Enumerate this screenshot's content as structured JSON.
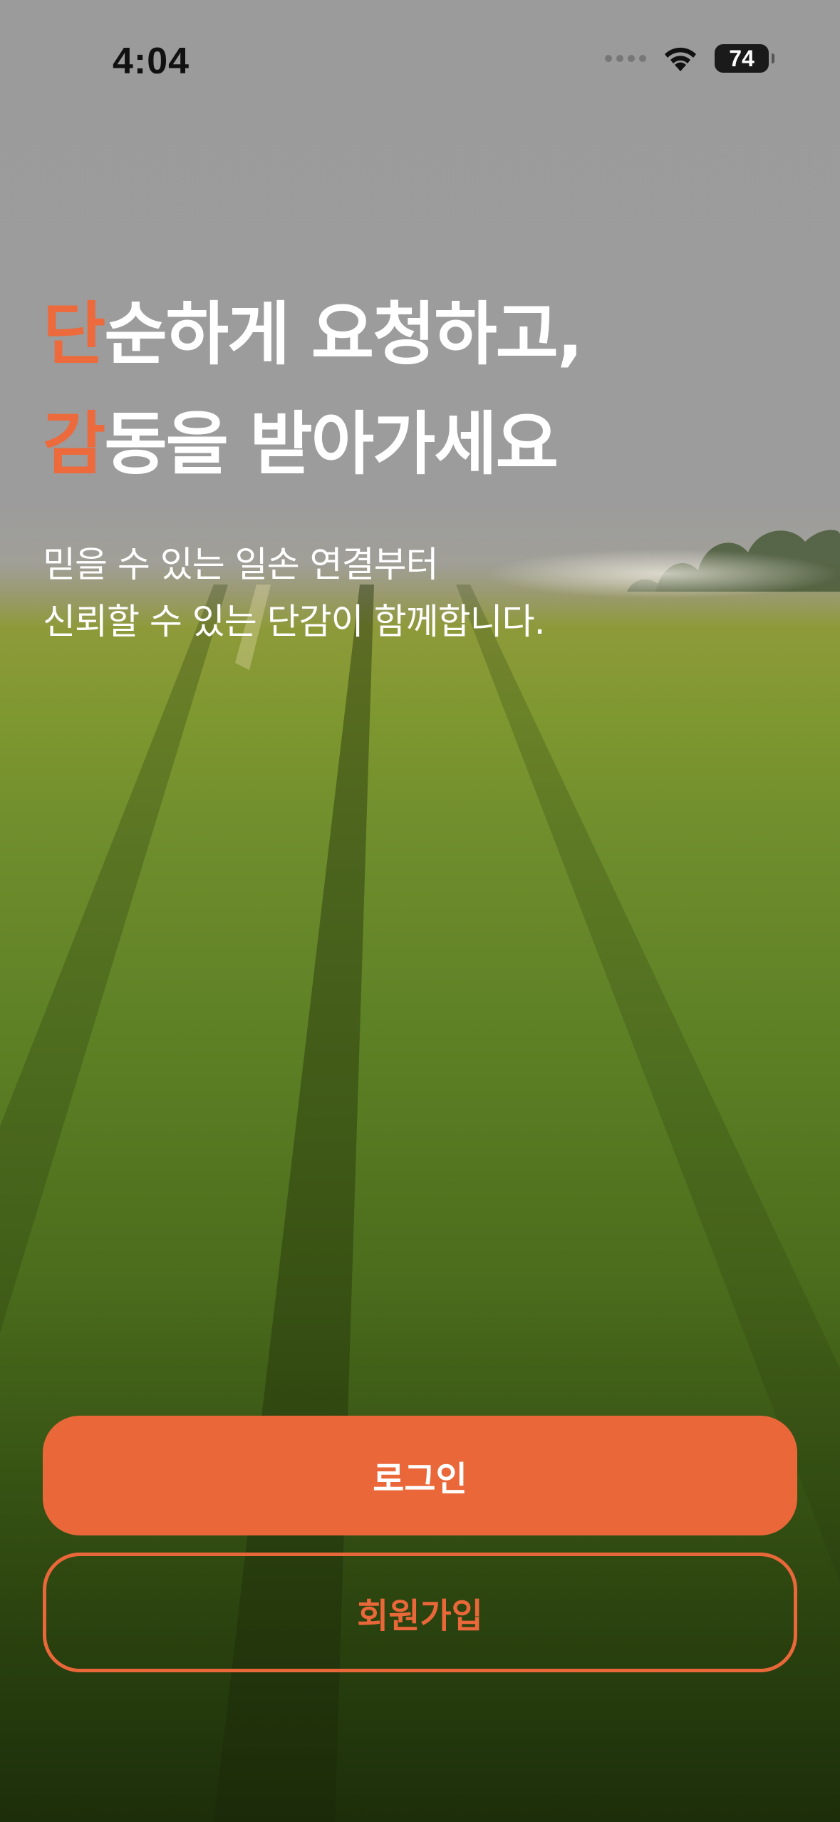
{
  "status_bar": {
    "time": "4:04",
    "battery_level": "74",
    "icons": [
      "signal-dots-icon",
      "wifi-icon",
      "battery-icon"
    ]
  },
  "hero": {
    "line1_accent": "단",
    "line1_rest": "순하게 요청하고,",
    "line2_accent": "감",
    "line2_rest": "동을 받아가세요",
    "subtitle_line1": "믿을 수 있는 일손 연결부터",
    "subtitle_line2": "신뢰할 수 있는 단감이 함께합니다."
  },
  "actions": {
    "login_label": "로그인",
    "signup_label": "회원가입"
  },
  "colors": {
    "accent": "#ea673a",
    "text_light": "#ffffff"
  }
}
